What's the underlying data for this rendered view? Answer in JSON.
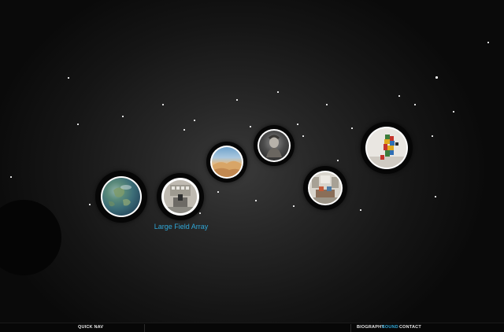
{
  "highlighted_label": "Large Field Array",
  "quick_nav_label": "QUICK NAV",
  "nav_links": [
    {
      "label": "BIOGRAPHY",
      "color": "#e6e6e6"
    },
    {
      "label": "SOUND",
      "color": "#2fa6d6"
    },
    {
      "label": "CONTACT",
      "color": "#e6e6e6"
    }
  ],
  "colors": {
    "accent": "#2fa6d6",
    "background": "#0c0c0c"
  }
}
